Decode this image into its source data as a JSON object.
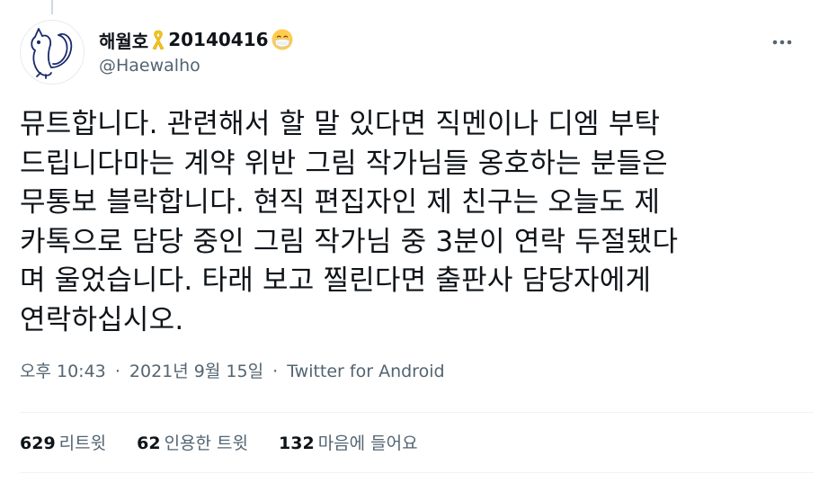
{
  "tweet": {
    "author": {
      "display_name": "해월호",
      "display_name_tail": "20140416",
      "handle": "@Haewalho",
      "badges": [
        "yellow-ribbon-icon",
        "face-with-mask-icon"
      ]
    },
    "text": "뮤트합니다. 관련해서 할 말 있다면 직멘이나 디엠 부탁\n드립니다마는 계약 위반 그림 작가님들 옹호하는 분들은\n무통보 블락합니다. 현직 편집자인 제 친구는 오늘도 제\n카톡으로 담당 중인 그림 작가님 중 3분이 연락 두절됐다\n며 울었습니다. 타래 보고 찔린다면 출판사 담당자에게\n연락하십시오.",
    "time": "오후 10:43",
    "date": "2021년 9월 15일",
    "separator": "·",
    "source": "Twitter for Android",
    "stats": {
      "retweets": {
        "count": "629",
        "label": "리트윗"
      },
      "quotes": {
        "count": "62",
        "label": "인용한 트윗"
      },
      "likes": {
        "count": "132",
        "label": "마음에 들어요"
      }
    },
    "more_icon": "more-horizontal-icon"
  },
  "colors": {
    "text_primary": "#0f1419",
    "text_secondary": "#536471",
    "divider": "#eff3f4",
    "ribbon": "#f5c518"
  }
}
